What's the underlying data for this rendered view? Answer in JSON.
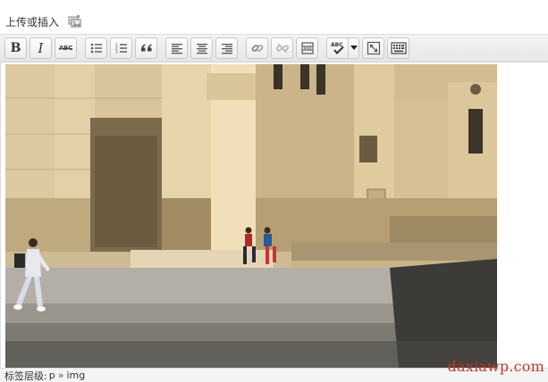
{
  "upload": {
    "label": "上传或插入",
    "media_icon": "add-media-icon"
  },
  "toolbar": {
    "bold_label": "B",
    "italic_label": "I",
    "strikethrough_label": "ABC",
    "buttons": [
      "bold-icon",
      "italic-icon",
      "strikethrough-icon",
      "unordered-list-icon",
      "ordered-list-icon",
      "blockquote-icon",
      "align-left-icon",
      "align-center-icon",
      "align-right-icon",
      "link-icon",
      "unlink-icon",
      "more-tag-icon",
      "spellcheck-icon",
      "fullscreen-icon",
      "kitchen-sink-icon"
    ]
  },
  "editor": {
    "content_icon": "photo-image"
  },
  "statusbar": {
    "label": "标签层级:",
    "path": [
      "p",
      "img"
    ],
    "separator": "»"
  },
  "watermark": {
    "text": "daxiawp.com",
    "color": "#c0392b"
  }
}
